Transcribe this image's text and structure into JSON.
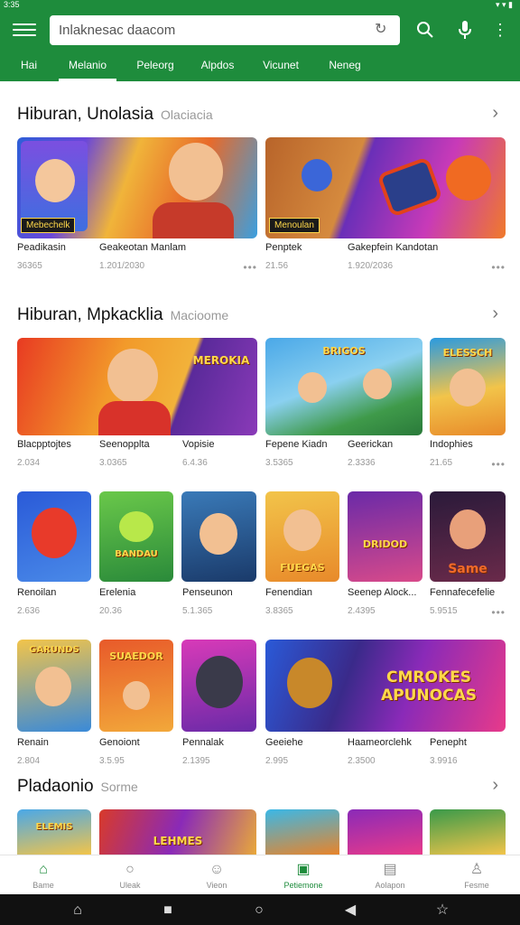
{
  "status": {
    "time": "3:35",
    "icons": "▾ ▾ ▮"
  },
  "search": {
    "text": "Inlaknesac daacom"
  },
  "tabs": [
    "Hai",
    "Melanio",
    "Peleorg",
    "Alpdos",
    "Vicunet",
    "Neneg"
  ],
  "sections": [
    {
      "title": "Hiburan, Unolasia",
      "subtitle": "Olaciacia"
    },
    {
      "title": "Hiburan, Mpkacklia",
      "subtitle": "Macioome"
    },
    {
      "title": "Pladaonio",
      "subtitle": "Sorme"
    }
  ],
  "row1": [
    {
      "name": "Peadikasin",
      "stat": "36365",
      "badge": "Mebechelk"
    },
    {
      "name": "Geakeotan Manlam",
      "stat": "1.201/2030"
    },
    {
      "name": "Penptek",
      "stat": "21.56",
      "badge": "Menoulan"
    },
    {
      "name": "Gakepfein Kandotan",
      "stat": "1.920/2036"
    }
  ],
  "row2": [
    {
      "name": "Blacpptojtes",
      "stat": "2.034"
    },
    {
      "name": "Seenopplta",
      "stat": "3.0365"
    },
    {
      "name": "Vopisie",
      "stat": "6.4.36"
    },
    {
      "name": "Fepene Kiadn",
      "stat": "3.5365"
    },
    {
      "name": "Geerickan",
      "stat": "2.3336"
    },
    {
      "name": "Indophies",
      "stat": "21.65"
    }
  ],
  "row3": [
    {
      "name": "Renoilan",
      "stat": "2.636"
    },
    {
      "name": "Erelenia",
      "stat": "20.36"
    },
    {
      "name": "Penseunon",
      "stat": "5.1.365"
    },
    {
      "name": "Fenendian",
      "stat": "3.8365"
    },
    {
      "name": "Seenep Alock...",
      "stat": "2.4395"
    },
    {
      "name": "Fennafecefelie",
      "stat": "5.9515"
    }
  ],
  "row4": [
    {
      "name": "Renain",
      "stat": "2.804"
    },
    {
      "name": "Genoiont",
      "stat": "3.5.95"
    },
    {
      "name": "Pennalak",
      "stat": "2.1395"
    },
    {
      "name": "Geeiehe",
      "stat": "2.995"
    },
    {
      "name": "Haameorclehk",
      "stat": "2.3500"
    },
    {
      "name": "Penepht",
      "stat": "3.9916"
    }
  ],
  "art_text": {
    "r2c2": "MEROKIA",
    "r2c4": "BRIGOS",
    "r2c6": "ELESSCH",
    "r3c2": "BANDAU",
    "r3c4": "FUEGAS",
    "r3c5": "DRIDOD",
    "r3c6": "Same",
    "r4c1": "GARUNDS",
    "r4c2": "SUAEDOR",
    "r4c5": "CMROKES APUNOCAS",
    "r5c1": "ELEMIS",
    "r5c2": "LEHMES"
  },
  "bottom_nav": [
    {
      "label": "Bame",
      "icon": "home-icon"
    },
    {
      "label": "Uleak",
      "icon": "search-icon"
    },
    {
      "label": "Vieon",
      "icon": "person-icon"
    },
    {
      "label": "Petiemone",
      "icon": "apps-icon"
    },
    {
      "label": "Aolapon",
      "icon": "book-icon"
    },
    {
      "label": "Fesme",
      "icon": "account-icon"
    }
  ],
  "colors": {
    "brand": "#1e8c3c",
    "background": "#ffffff"
  }
}
